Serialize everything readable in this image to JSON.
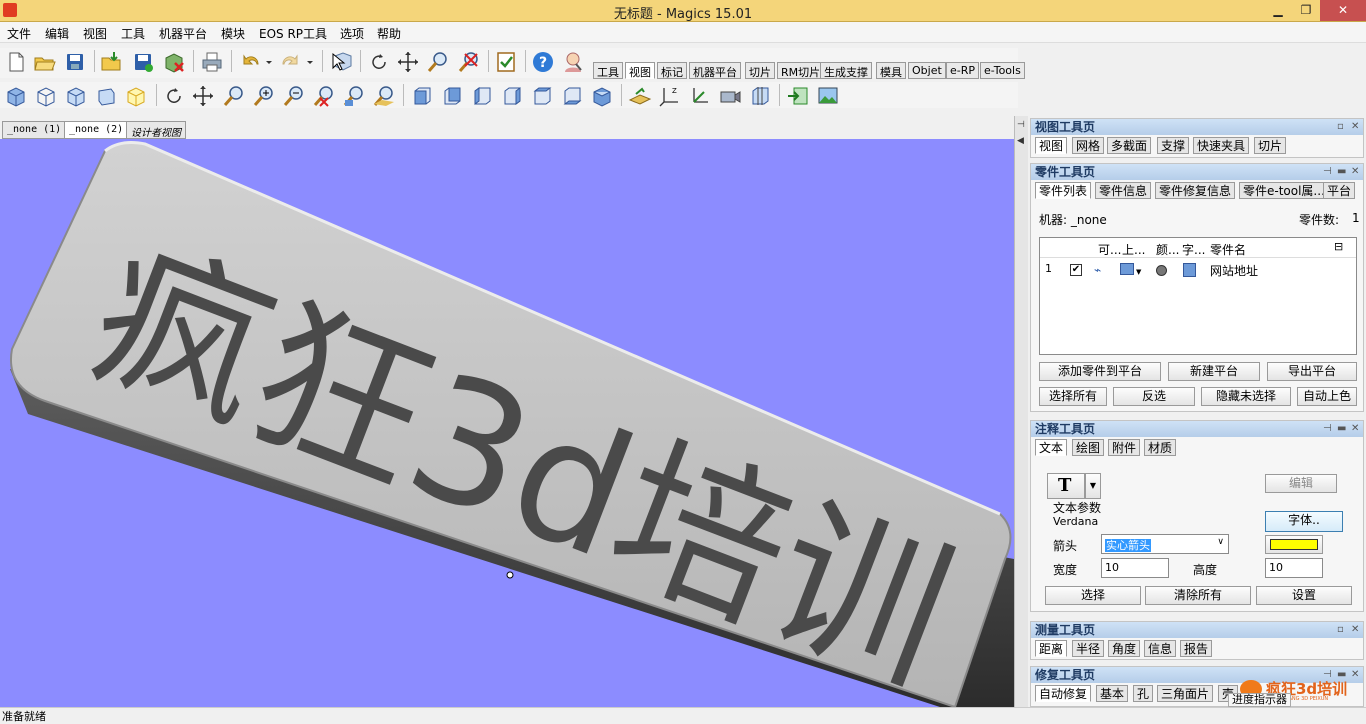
{
  "window": {
    "title": "无标题 - Magics 15.01",
    "min": "▁",
    "max": "❐",
    "close": "✕"
  },
  "menu": [
    "文件",
    "编辑",
    "视图",
    "工具",
    "机器平台",
    "模块",
    "EOS RP工具",
    "选项",
    "帮助"
  ],
  "toolbar_tabs": [
    "工具",
    "视图",
    "标记",
    "机器平台",
    "切片",
    "RM切片",
    "生成支撑",
    "模具",
    "Objet",
    "e-RP",
    "e-Tools"
  ],
  "doc_tabs": [
    "_none (1)",
    "_none (2)",
    "设计者视图"
  ],
  "viewport": {
    "bg": "#8c8cff",
    "engraved_text": "疯狂3d培训",
    "text_color": "#4a4a4a",
    "slab_color": "#bdbdbd"
  },
  "status": {
    "text": "准备就绪"
  },
  "view_panel": {
    "title": "视图工具页",
    "tabs": [
      "视图",
      "网格",
      "多截面",
      "支撑",
      "快速夹具",
      "切片"
    ]
  },
  "parts_panel": {
    "title": "零件工具页",
    "tabs": [
      "零件列表",
      "零件信息",
      "零件修复信息",
      "零件e-tool属...",
      "平台"
    ],
    "machine_label": "机器: _none",
    "count_label": "零件数:",
    "count": "1",
    "columns": [
      "可...",
      "上...",
      "颜...",
      "字...",
      "零件名"
    ],
    "rows": [
      {
        "index": "1",
        "name": "网站地址"
      }
    ],
    "buttons": [
      "添加零件到平台",
      "新建平台",
      "导出平台",
      "选择所有",
      "反选",
      "隐藏未选择",
      "自动上色"
    ]
  },
  "annot_panel": {
    "title": "注释工具页",
    "tabs": [
      "文本",
      "绘图",
      "附件",
      "材质"
    ],
    "t_button": "T",
    "edit_button": "编辑",
    "section_label": "文本参数",
    "font_name": "Verdana",
    "font_button": "字体..",
    "arrow_label": "箭头",
    "arrow_value": "实心箭头",
    "color": "#ffff00",
    "width_label": "宽度",
    "width_value": "10",
    "height_label": "高度",
    "height_value": "10",
    "buttons": [
      "选择",
      "清除所有",
      "设置"
    ]
  },
  "measure_panel": {
    "title": "测量工具页",
    "tabs": [
      "距离",
      "半径",
      "角度",
      "信息",
      "报告"
    ]
  },
  "fix_panel": {
    "title": "修复工具页",
    "tabs": [
      "自动修复",
      "基本",
      "孔",
      "三角面片",
      "壳"
    ]
  },
  "progress_label": "进度指示器",
  "watermark": {
    "main": "疯狂3d培训",
    "sub": "FENGKUANG 3D PEIXUN"
  }
}
